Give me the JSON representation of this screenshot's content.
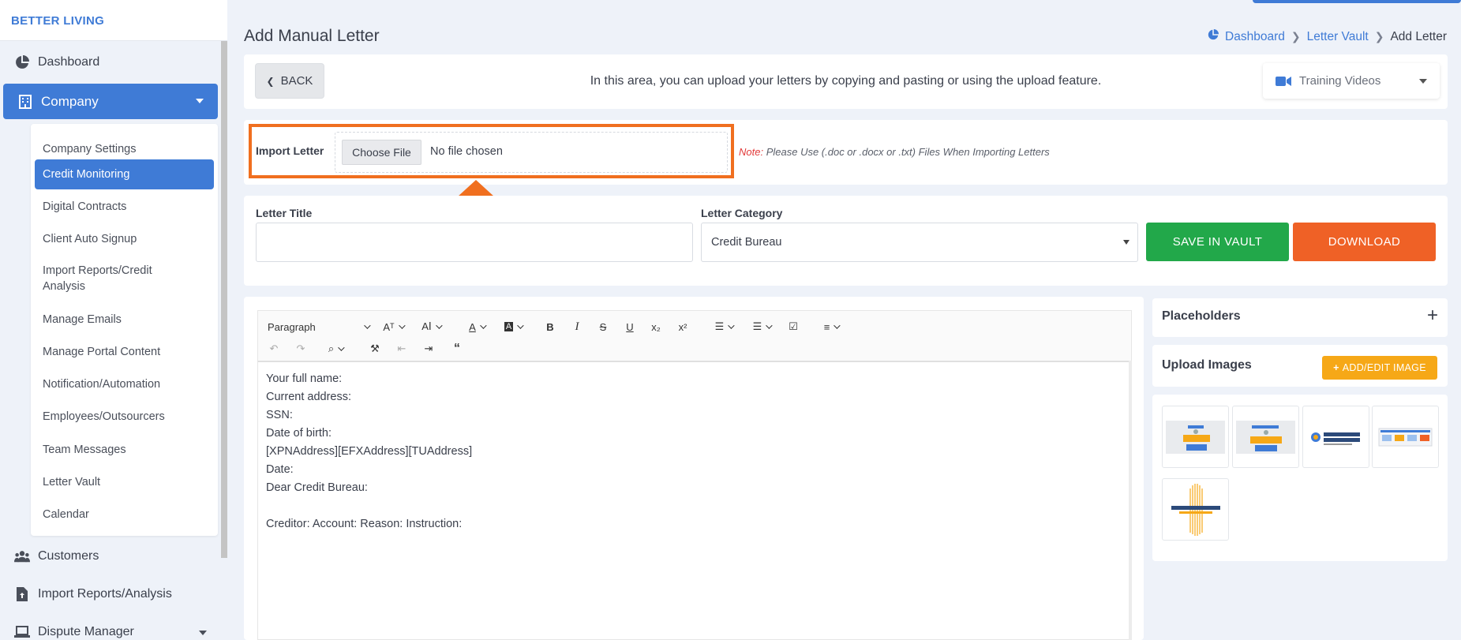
{
  "brand": "BETTER LIVING",
  "sidebar": {
    "items": [
      {
        "label": "Dashboard",
        "icon": "pie-chart-icon"
      },
      {
        "label": "Company",
        "icon": "building-icon"
      },
      {
        "label": "Customers",
        "icon": "users-icon"
      },
      {
        "label": "Import Reports/Analysis",
        "icon": "file-upload-icon"
      },
      {
        "label": "Dispute Manager",
        "icon": "laptop-icon"
      }
    ],
    "submenu": [
      "Company Settings",
      "Credit Monitoring",
      "Digital Contracts",
      "Client Auto Signup",
      "Import Reports/Credit Analysis",
      "Manage Emails",
      "Manage Portal Content",
      "Notification/Automation",
      "Employees/Outsourcers",
      "Team Messages",
      "Letter Vault",
      "Calendar"
    ]
  },
  "page": {
    "title": "Add Manual Letter",
    "breadcrumb": [
      "Dashboard",
      "Letter Vault",
      "Add Letter"
    ]
  },
  "top_card": {
    "back_label": "BACK",
    "info": "In this area, you can upload your letters by copying and pasting or using the upload feature.",
    "training_videos": "Training Videos"
  },
  "import": {
    "label": "Import Letter",
    "choose_label": "Choose File",
    "no_file": "No file chosen",
    "note_prefix": "Note:",
    "note": "Please Use (.doc or .docx or .txt) Files When Importing Letters"
  },
  "form": {
    "title_label": "Letter Title",
    "title_value": "",
    "category_label": "Letter Category",
    "category_value": "Credit Bureau",
    "save_label": "SAVE IN VAULT",
    "download_label": "DOWNLOAD"
  },
  "editor": {
    "paragraph": "Paragraph",
    "lines": [
      "Your full name:",
      "Current address:",
      "SSN:",
      "Date of birth:",
      "[XPNAddress][EFXAddress][TUAddress]",
      "Date:",
      "Dear Credit Bureau:",
      "",
      "Creditor: Account: Reason: Instruction:"
    ]
  },
  "panels": {
    "placeholders": "Placeholders",
    "upload_images": "Upload Images",
    "add_edit_image": "ADD/EDIT IMAGE"
  },
  "colors": {
    "primary": "#3f7bd6",
    "save": "#22a84a",
    "download": "#ef6126",
    "highlight": "#f06f1f",
    "add_image": "#f6a817"
  }
}
